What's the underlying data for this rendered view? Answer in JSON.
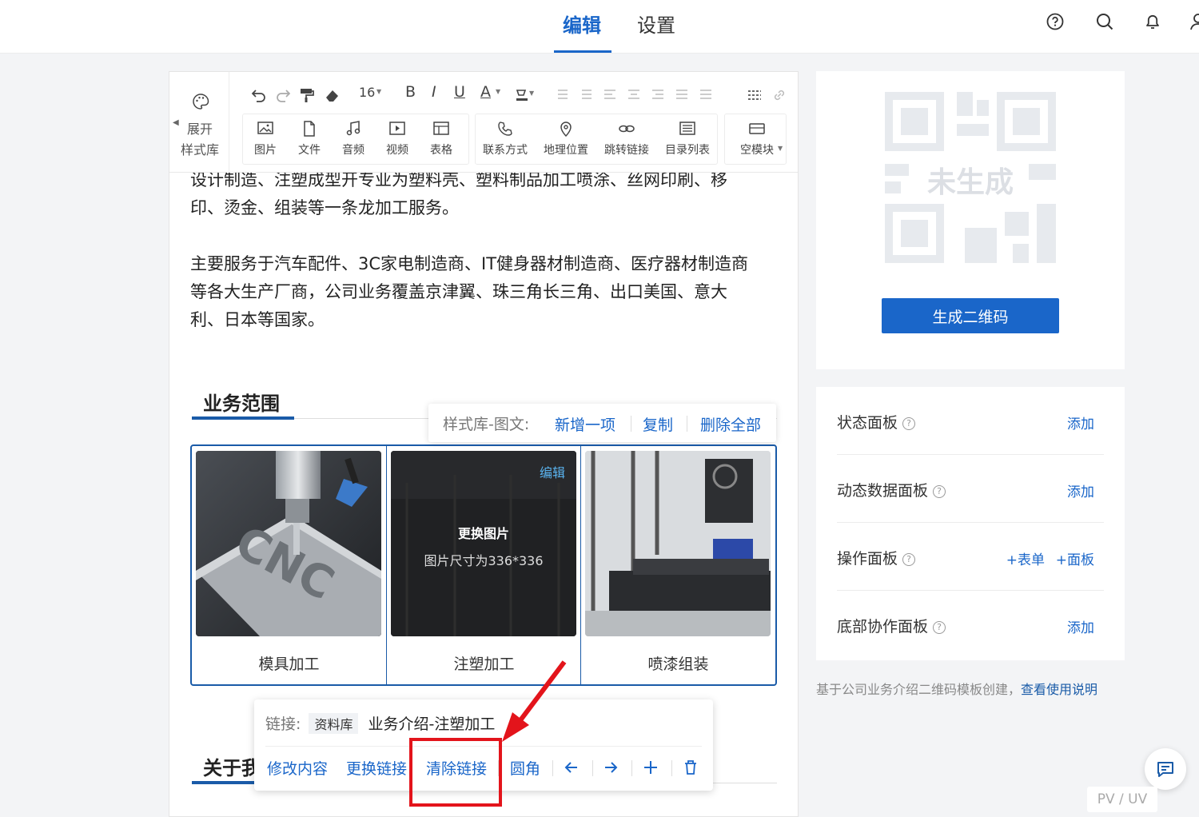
{
  "header": {
    "tabs": [
      {
        "label": "编辑",
        "active": true
      },
      {
        "label": "设置",
        "active": false
      }
    ],
    "icons": [
      "help-icon",
      "search-icon",
      "bell-icon",
      "user-icon"
    ]
  },
  "toolbar": {
    "style_library": {
      "line1": "展开",
      "line2": "样式库"
    },
    "font_size": "16",
    "format_buttons": [
      "B",
      "I",
      "U",
      "A"
    ],
    "insert_group1": [
      "图片",
      "文件",
      "音频",
      "视频",
      "表格"
    ],
    "insert_group2": [
      "联系方式",
      "地理位置",
      "跳转链接",
      "目录列表"
    ],
    "insert_group3": [
      "空模块"
    ]
  },
  "content": {
    "para1_line1": "设计制造、注塑成型开专业为塑料壳、塑料制品加工喷涂、丝网印刷、移",
    "para1_line2": "印、烫金、组装等一条龙加工服务。",
    "para2_line1": "主要服务于汽车配件、3C家电制造商、IT健身器材制造商、医疗器材制造商",
    "para2_line2": "等各大生产厂商，公司业务覆盖京津翼、珠三角长三角、出口美国、意大",
    "para2_line3": "利、日本等国家。",
    "section1_title": "业务范围",
    "section2_title": "关于我"
  },
  "float_toolbar": {
    "label": "样式库-图文:",
    "add": "新增一项",
    "copy": "复制",
    "delete_all": "删除全部"
  },
  "gallery": {
    "items": [
      {
        "caption": "模具加工"
      },
      {
        "caption": "注塑加工",
        "edit": "编辑",
        "overlay_title": "更换图片",
        "overlay_size": "图片尺寸为336*336"
      },
      {
        "caption": "喷漆组装"
      }
    ]
  },
  "link_popup": {
    "link_label": "链接:",
    "tag": "资料库",
    "link_value": "业务介绍-注塑加工",
    "actions": [
      "修改内容",
      "更换链接",
      "清除链接",
      "圆角"
    ]
  },
  "qr": {
    "status": "未生成",
    "button": "生成二维码"
  },
  "panels": [
    {
      "name": "状态面板",
      "actions": [
        "添加"
      ]
    },
    {
      "name": "动态数据面板",
      "actions": [
        "添加"
      ]
    },
    {
      "name": "操作面板",
      "actions": [
        "+表单",
        "+面板"
      ]
    },
    {
      "name": "底部协作面板",
      "actions": [
        "添加"
      ]
    }
  ],
  "note": {
    "text": "基于公司业务介绍二维码模板创建，",
    "link": "查看使用说明"
  },
  "footer": {
    "pvuv": "PV / UV"
  },
  "colors": {
    "accent": "#1a66c9",
    "highlight": "#e3141b"
  }
}
